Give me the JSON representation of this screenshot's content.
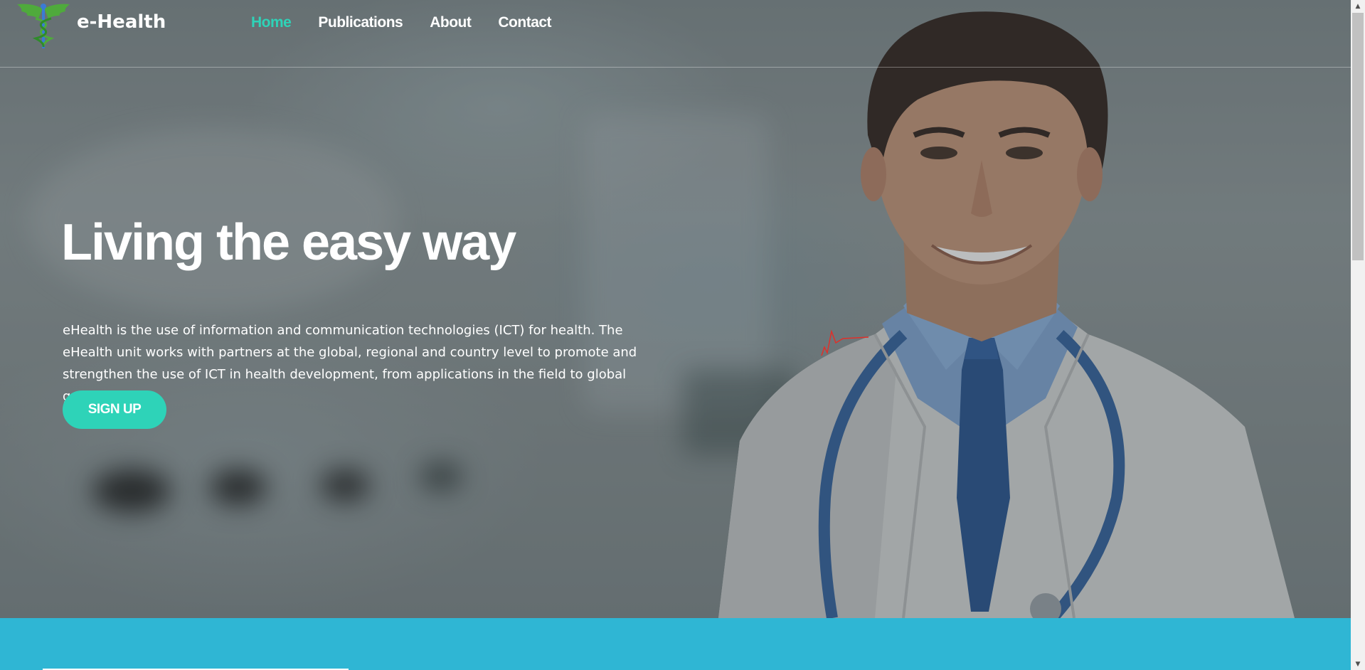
{
  "brand": {
    "name": "e-Health",
    "logo_icon": "caduceus-icon",
    "accent_color": "#2ed3b8"
  },
  "nav": {
    "items": [
      {
        "label": "Home",
        "active": true
      },
      {
        "label": "Publications",
        "active": false
      },
      {
        "label": "About",
        "active": false
      },
      {
        "label": "Contact",
        "active": false
      }
    ]
  },
  "hero": {
    "title": "Living the easy way",
    "description": "eHealth is the use of information and communication technologies (ICT) for health. The eHealth unit works with partners at the global, regional and country level to promote and strengthen the use of ICT in health development, from applications in the field to global governance.",
    "signup_label": "SIGN UP",
    "decor_icon": "heartbeat-icon"
  },
  "colors": {
    "band": "#2fb6d4",
    "button": "#2ed3b8"
  }
}
